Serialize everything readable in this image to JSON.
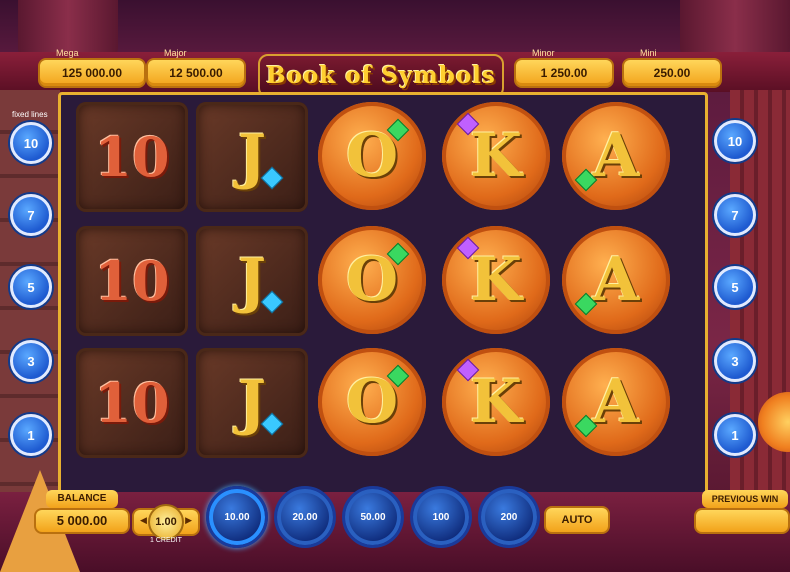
{
  "title": "Book of Symbols",
  "jackpots": [
    {
      "label": "Mega",
      "value": "125 000.00"
    },
    {
      "label": "Major",
      "value": "12 500.00"
    },
    {
      "label": "Minor",
      "value": "1 250.00"
    },
    {
      "label": "Mini",
      "value": "250.00"
    }
  ],
  "fixed_lines_label": "fixed lines",
  "lines": [
    "10",
    "7",
    "5",
    "3",
    "1"
  ],
  "reels": [
    [
      "10",
      "10",
      "10"
    ],
    [
      "J",
      "J",
      "J"
    ],
    [
      "O",
      "O",
      "O"
    ],
    [
      "K",
      "K",
      "K"
    ],
    [
      "A",
      "A",
      "A"
    ]
  ],
  "balance": {
    "label": "BALANCE",
    "value": "5 000.00"
  },
  "credit": {
    "value": "1.00",
    "label": "1 CREDIT"
  },
  "bets": [
    "10.00",
    "20.00",
    "50.00",
    "100",
    "200"
  ],
  "auto_label": "AUTO",
  "previous_win": {
    "label": "PREVIOUS WIN",
    "value": ""
  },
  "colors": {
    "gold": "#f2a21a",
    "frame": "#2a1a3a",
    "blue": "#1e5ad0"
  }
}
